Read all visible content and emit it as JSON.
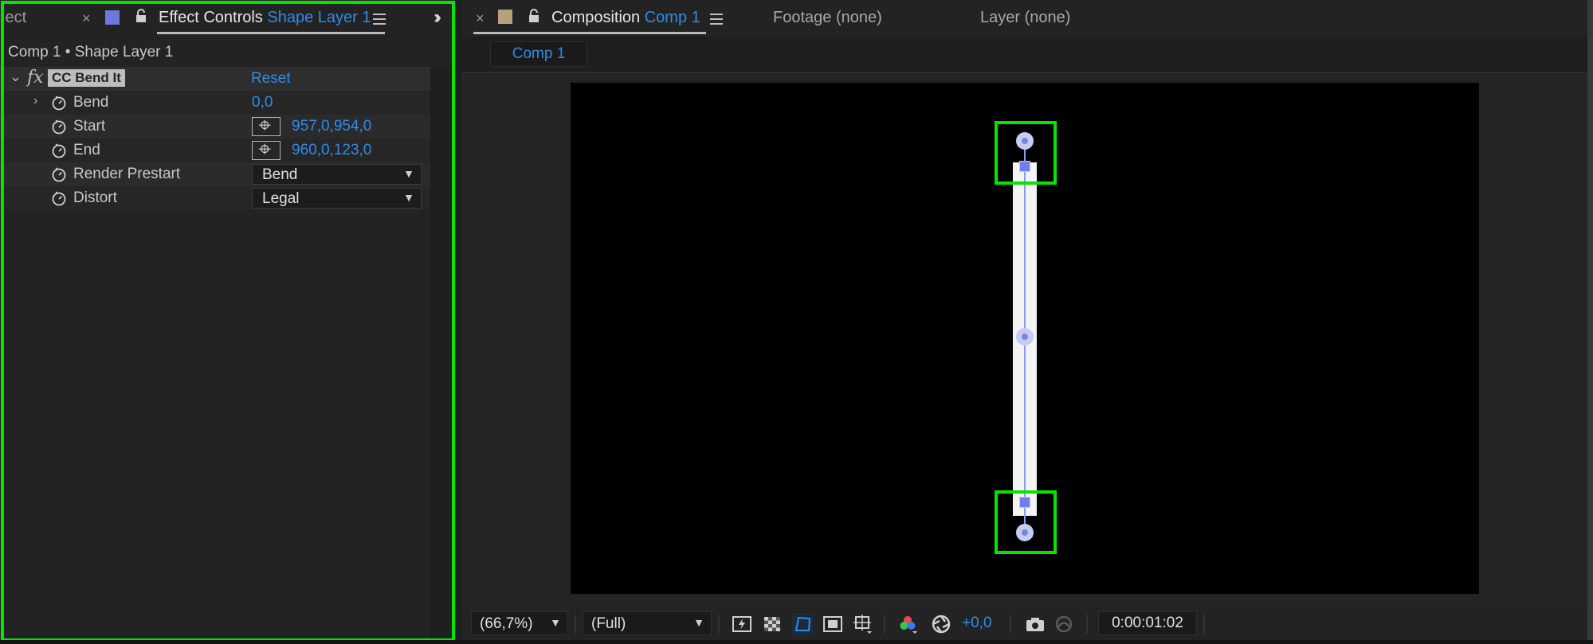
{
  "left_panel": {
    "tab_project_label": "ject",
    "tab_effect_controls": {
      "title": "Effect Controls",
      "layer": "Shape Layer 1",
      "swatch_color": "#6c78e0"
    },
    "breadcrumb": "Comp 1 • Shape Layer 1",
    "effect": {
      "fx_label": "fx",
      "name": "CC Bend It",
      "reset_label": "Reset",
      "properties": [
        {
          "label": "Bend",
          "value": "0,0"
        },
        {
          "label": "Start",
          "value": "957,0,954,0"
        },
        {
          "label": "End",
          "value": "960,0,123,0"
        },
        {
          "label": "Render Prestart",
          "value": "Bend"
        },
        {
          "label": "Distort",
          "value": "Legal"
        }
      ]
    }
  },
  "right_panel": {
    "tab_composition": {
      "title": "Composition",
      "comp": "Comp 1",
      "swatch_color": "#b8a07a"
    },
    "tab_footage": "Footage (none)",
    "tab_layer": "Layer (none)",
    "comp_subtab": "Comp 1",
    "bottom_bar": {
      "zoom": "(66,7%)",
      "resolution": "(Full)",
      "exposure": "+0,0",
      "timecode": "0:00:01:02"
    }
  },
  "colors": {
    "accent_blue": "#2d8ceb",
    "highlight_green": "#08e400",
    "handle_blue": "#6f80e8"
  },
  "icons": [
    "close-icon",
    "lock-icon",
    "panel-menu-icon",
    "overflow-chevrons-icon",
    "chevron-down-icon",
    "chevron-right-icon",
    "stopwatch-icon",
    "crosshair-icon",
    "fast-preview-icon",
    "transparency-grid-icon",
    "mask-path-icon",
    "region-of-interest-icon",
    "grid-guides-icon",
    "color-channel-icon",
    "exposure-reset-icon",
    "camera-icon",
    "show-snapshot-icon"
  ]
}
